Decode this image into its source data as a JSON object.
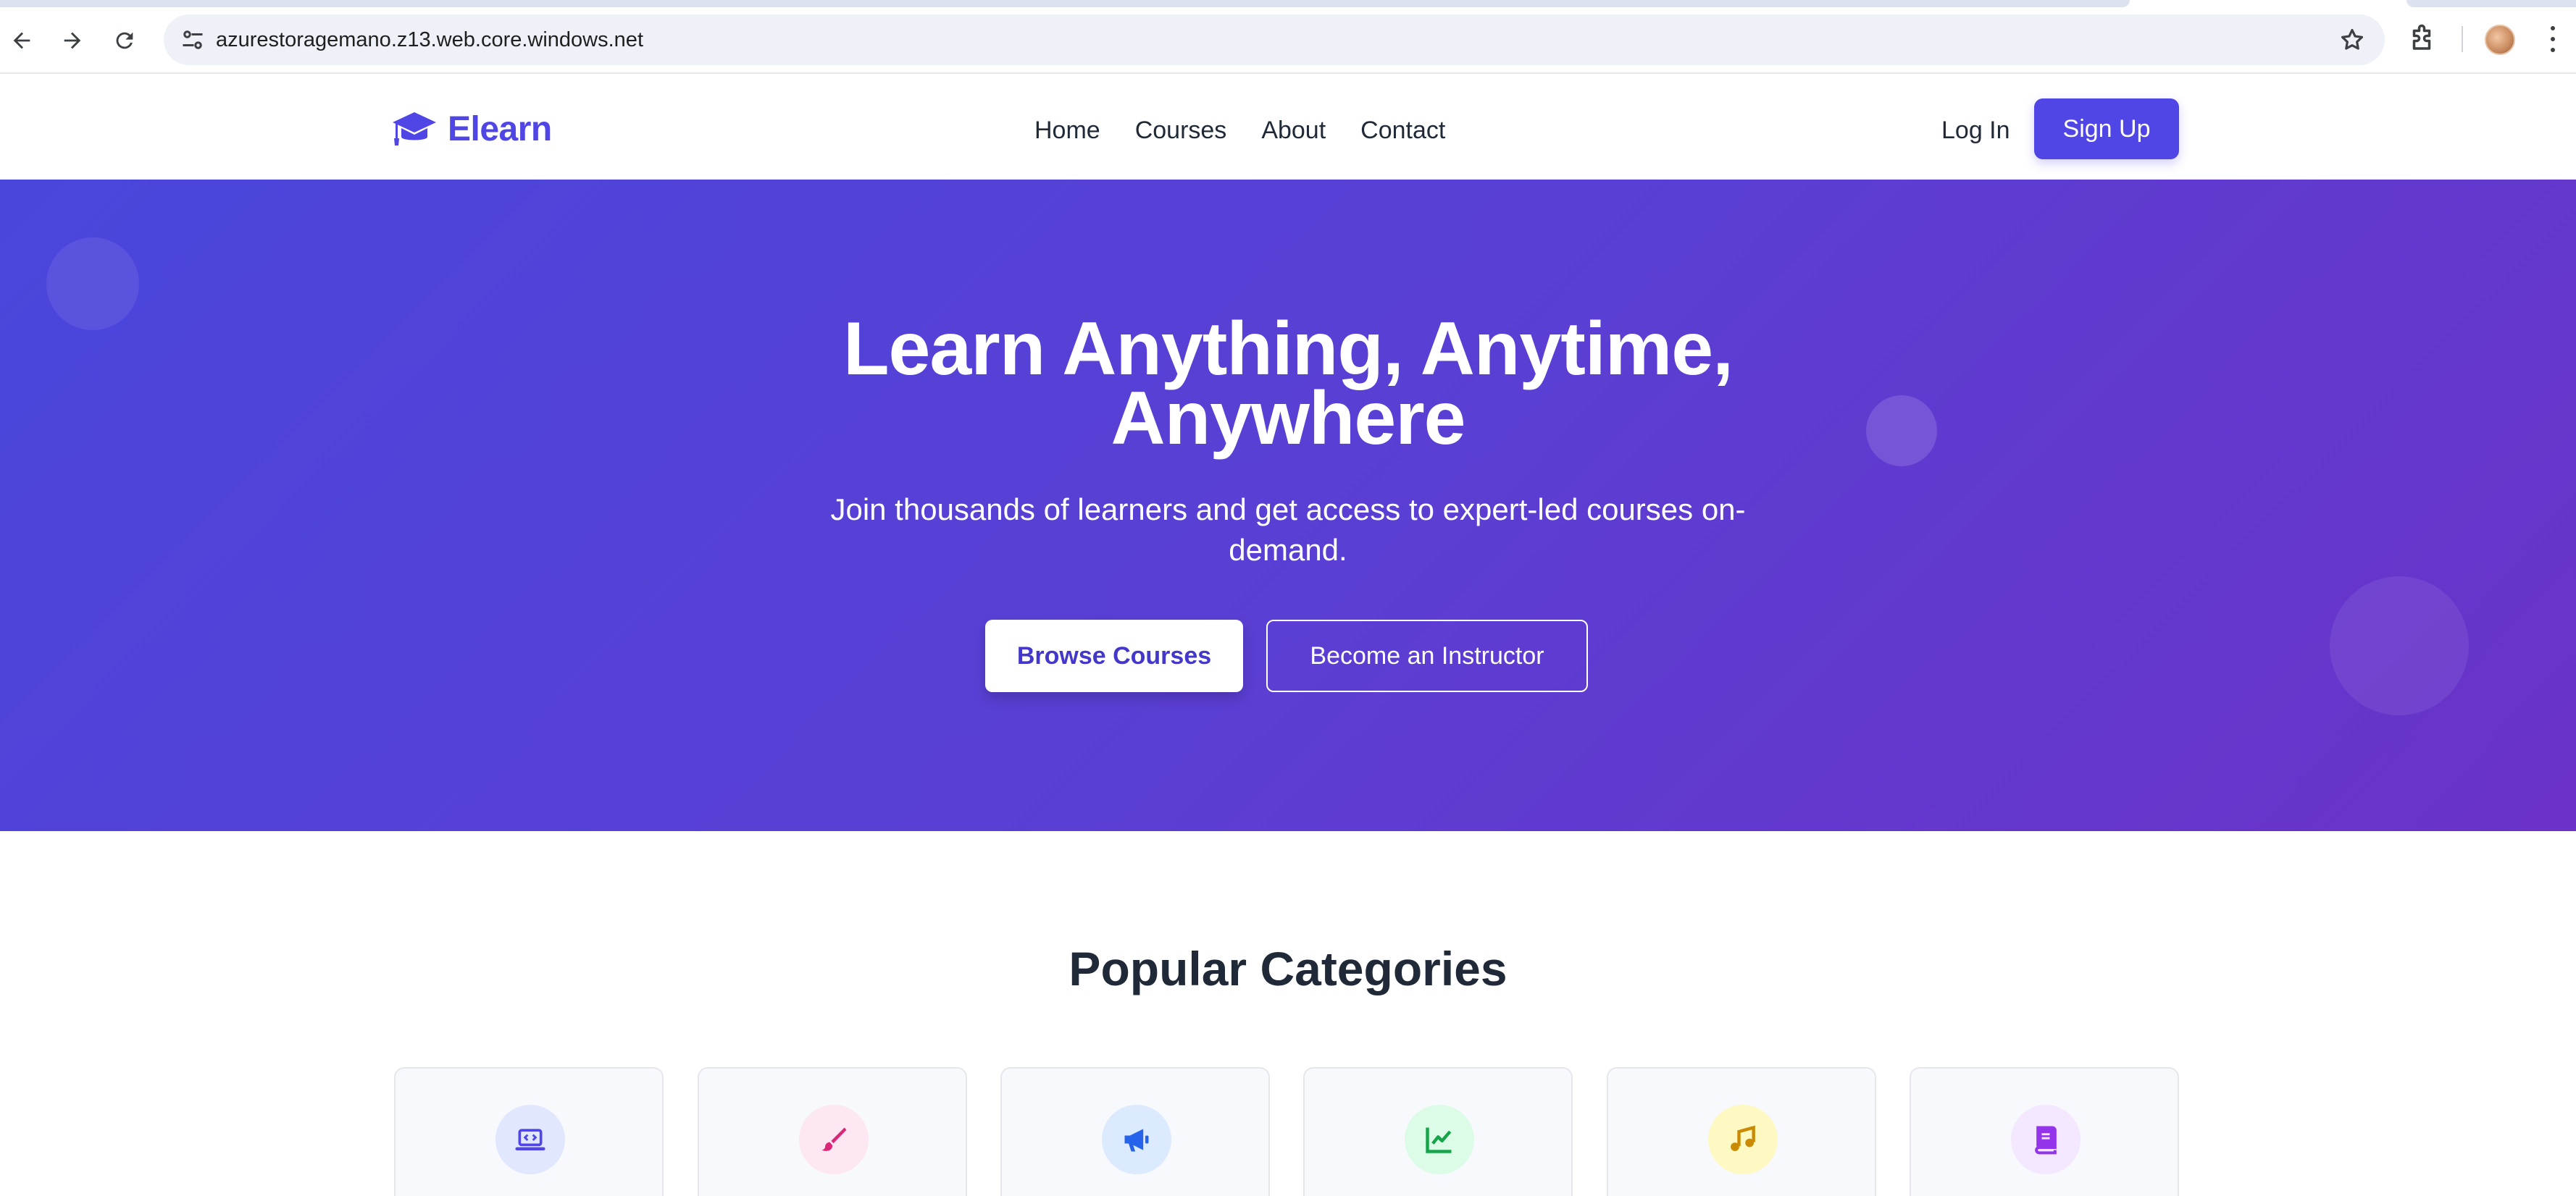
{
  "browser": {
    "url": "azurestoragemano.z13.web.core.windows.net"
  },
  "site": {
    "brand": "Elearn",
    "nav": [
      "Home",
      "Courses",
      "About",
      "Contact"
    ],
    "login_label": "Log In",
    "signup_label": "Sign Up"
  },
  "hero": {
    "title": "Learn Anything, Anytime, Anywhere",
    "subtitle": "Join thousands of learners and get access to expert-led courses on-demand.",
    "primary_button": "Browse Courses",
    "secondary_button": "Become an Instructor"
  },
  "categories": {
    "title": "Popular Categories",
    "items": [
      {
        "icon": "laptop-code-icon",
        "color": "#4f46e5",
        "bg": "#e0e7ff"
      },
      {
        "icon": "paint-brush-icon",
        "color": "#db2777",
        "bg": "#fce7f3"
      },
      {
        "icon": "megaphone-icon",
        "color": "#2563eb",
        "bg": "#dbeafe"
      },
      {
        "icon": "chart-line-icon",
        "color": "#16a34a",
        "bg": "#dcfce7"
      },
      {
        "icon": "music-icon",
        "color": "#ca8a04",
        "bg": "#fef9c3"
      },
      {
        "icon": "book-icon",
        "color": "#9333ea",
        "bg": "#f3e8ff"
      }
    ]
  },
  "colors": {
    "brand": "#4f46e5",
    "hero_gradient_start": "#4a46dc",
    "hero_gradient_end": "#6a32c8"
  }
}
